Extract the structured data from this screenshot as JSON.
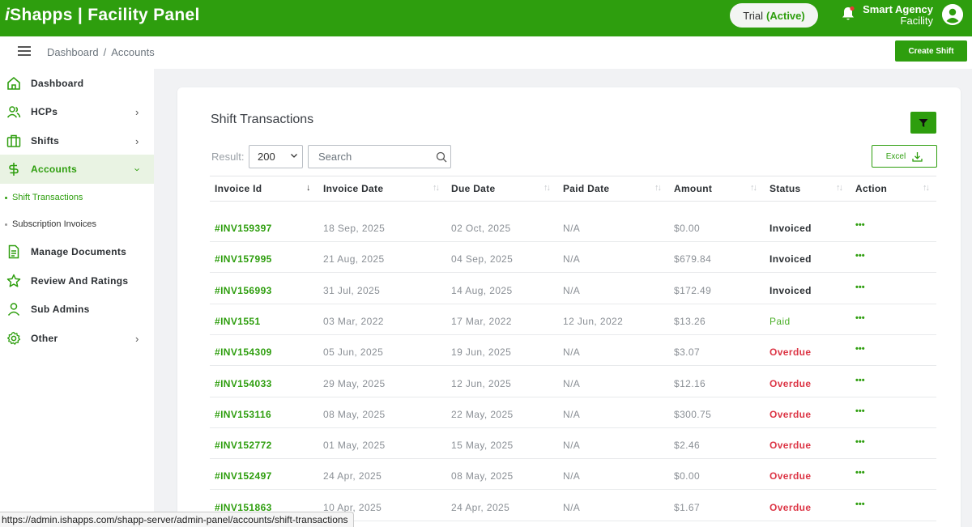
{
  "app": {
    "brand_prefix": "i",
    "brand_rest": "Shapps | Facility Panel",
    "trial_label": "Trial",
    "trial_status": "(Active)",
    "user_name": "Smart Agency",
    "user_role": "Facility"
  },
  "breadcrumb": {
    "item1": "Dashboard",
    "separator": "/",
    "item2": "Accounts"
  },
  "create_shift_label": "Create Shift",
  "sidebar": {
    "items": [
      {
        "label": "Dashboard",
        "icon": "home-icon"
      },
      {
        "label": "HCPs",
        "icon": "users-icon"
      },
      {
        "label": "Shifts",
        "icon": "briefcase-icon"
      },
      {
        "label": "Accounts",
        "icon": "dollar-icon"
      },
      {
        "label": "Manage Documents",
        "icon": "document-icon"
      },
      {
        "label": "Review And Ratings",
        "icon": "star-icon"
      },
      {
        "label": "Sub Admins",
        "icon": "user-icon"
      },
      {
        "label": "Other",
        "icon": "gear-icon"
      }
    ],
    "subitems": [
      {
        "label": "Shift Transactions"
      },
      {
        "label": "Subscription Invoices"
      }
    ]
  },
  "card": {
    "title": "Shift Transactions",
    "result_label": "Result:",
    "result_value": "200",
    "search_placeholder": "Search",
    "excel_label": "Excel"
  },
  "table": {
    "headers": [
      "Invoice Id",
      "Invoice Date",
      "Due Date",
      "Paid Date",
      "Amount",
      "Status",
      "Action"
    ],
    "rows": [
      {
        "id": "#INV159397",
        "invoice_date": "18 Sep, 2025",
        "due_date": "02 Oct, 2025",
        "paid_date": "N/A",
        "amount": "$0.00",
        "status": "Invoiced",
        "action": "•••"
      },
      {
        "id": "#INV157995",
        "invoice_date": "21 Aug, 2025",
        "due_date": "04 Sep, 2025",
        "paid_date": "N/A",
        "amount": "$679.84",
        "status": "Invoiced",
        "action": "•••"
      },
      {
        "id": "#INV156993",
        "invoice_date": "31 Jul, 2025",
        "due_date": "14 Aug, 2025",
        "paid_date": "N/A",
        "amount": "$172.49",
        "status": "Invoiced",
        "action": "•••"
      },
      {
        "id": "#INV1551",
        "invoice_date": "03 Mar, 2022",
        "due_date": "17 Mar, 2022",
        "paid_date": "12 Jun, 2022",
        "amount": "$13.26",
        "status": "Paid",
        "action": "•••"
      },
      {
        "id": "#INV154309",
        "invoice_date": "05 Jun, 2025",
        "due_date": "19 Jun, 2025",
        "paid_date": "N/A",
        "amount": "$3.07",
        "status": "Overdue",
        "action": "•••"
      },
      {
        "id": "#INV154033",
        "invoice_date": "29 May, 2025",
        "due_date": "12 Jun, 2025",
        "paid_date": "N/A",
        "amount": "$12.16",
        "status": "Overdue",
        "action": "•••"
      },
      {
        "id": "#INV153116",
        "invoice_date": "08 May, 2025",
        "due_date": "22 May, 2025",
        "paid_date": "N/A",
        "amount": "$300.75",
        "status": "Overdue",
        "action": "•••"
      },
      {
        "id": "#INV152772",
        "invoice_date": "01 May, 2025",
        "due_date": "15 May, 2025",
        "paid_date": "N/A",
        "amount": "$2.46",
        "status": "Overdue",
        "action": "•••"
      },
      {
        "id": "#INV152497",
        "invoice_date": "24 Apr, 2025",
        "due_date": "08 May, 2025",
        "paid_date": "N/A",
        "amount": "$0.00",
        "status": "Overdue",
        "action": "•••"
      },
      {
        "id": "#INV151863",
        "invoice_date": "10 Apr, 2025",
        "due_date": "24 Apr, 2025",
        "paid_date": "N/A",
        "amount": "$1.67",
        "status": "Overdue",
        "action": "•••"
      }
    ]
  },
  "status_url": "https://admin.ishapps.com/shapp-server/admin-panel/accounts/shift-transactions",
  "colors": {
    "brand": "#2e9e0e",
    "overdue": "#dc3545",
    "paid": "#4caf2a"
  }
}
